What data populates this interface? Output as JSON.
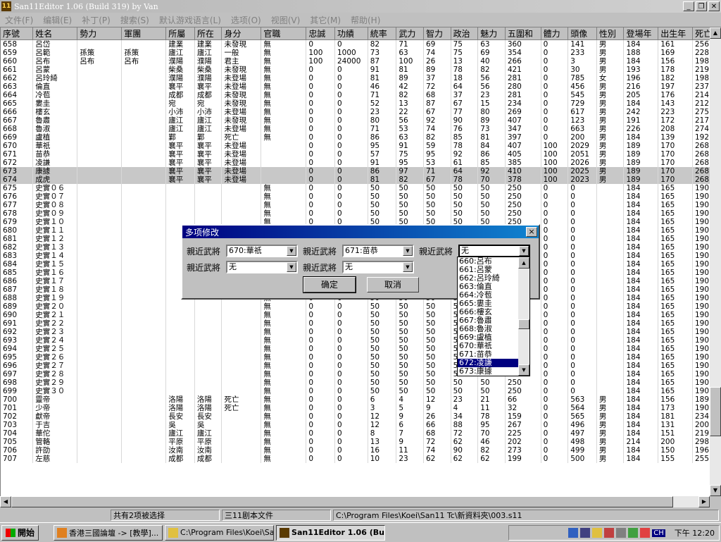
{
  "window": {
    "title": "San11Editor 1.06 (Build 319) by Van",
    "app_icon": "11"
  },
  "menubar": [
    "文件(F)",
    "编辑(E)",
    "补丁(P)",
    "搜索(S)",
    "默认游戏语言(L)",
    "选项(O)",
    "视图(V)",
    "其它(M)",
    "帮助(H)"
  ],
  "table": {
    "columns": [
      "序號",
      "姓名",
      "勢力",
      "軍團",
      "所屬",
      "所在",
      "身分",
      "官職",
      "忠誠",
      "功績",
      "統率",
      "武力",
      "智力",
      "政治",
      "魅力",
      "五圍和",
      "體力",
      "頭像",
      "性別",
      "登場年",
      "出生年",
      "死亡年"
    ],
    "rows": [
      [
        "658",
        "呂岱",
        "",
        "",
        "建業",
        "建業",
        "未發現",
        "無",
        "0",
        "0",
        "82",
        "71",
        "69",
        "75",
        "63",
        "360",
        "0",
        "141",
        "男",
        "184",
        "161",
        "256"
      ],
      [
        "659",
        "呂範",
        "孫策",
        "孫策",
        "廬江",
        "廬江",
        "一般",
        "無",
        "100",
        "1000",
        "73",
        "63",
        "74",
        "75",
        "69",
        "354",
        "0",
        "233",
        "男",
        "188",
        "169",
        "228"
      ],
      [
        "660",
        "呂布",
        "呂布",
        "呂布",
        "濮陽",
        "濮陽",
        "君主",
        "無",
        "100",
        "24000",
        "87",
        "100",
        "26",
        "13",
        "40",
        "266",
        "0",
        "3",
        "男",
        "184",
        "156",
        "198"
      ],
      [
        "661",
        "呂蒙",
        "",
        "",
        "柴桑",
        "柴桑",
        "未發現",
        "無",
        "0",
        "0",
        "91",
        "81",
        "89",
        "78",
        "82",
        "421",
        "0",
        "30",
        "男",
        "193",
        "178",
        "219"
      ],
      [
        "662",
        "呂玲綺",
        "",
        "",
        "濮陽",
        "濮陽",
        "未登場",
        "無",
        "0",
        "0",
        "81",
        "89",
        "37",
        "18",
        "56",
        "281",
        "0",
        "785",
        "女",
        "196",
        "182",
        "198"
      ],
      [
        "663",
        "倫直",
        "",
        "",
        "襄平",
        "襄平",
        "未登場",
        "無",
        "0",
        "0",
        "46",
        "42",
        "72",
        "64",
        "56",
        "280",
        "0",
        "456",
        "男",
        "216",
        "197",
        "237"
      ],
      [
        "664",
        "冷苞",
        "",
        "",
        "成都",
        "成都",
        "未發現",
        "無",
        "0",
        "0",
        "71",
        "82",
        "68",
        "37",
        "23",
        "281",
        "0",
        "545",
        "男",
        "205",
        "176",
        "214"
      ],
      [
        "665",
        "婁圭",
        "",
        "",
        "宛",
        "宛",
        "未發現",
        "無",
        "0",
        "0",
        "52",
        "13",
        "87",
        "67",
        "15",
        "234",
        "0",
        "729",
        "男",
        "184",
        "143",
        "212"
      ],
      [
        "666",
        "樓玄",
        "",
        "",
        "小沛",
        "小沛",
        "未登場",
        "無",
        "0",
        "0",
        "23",
        "22",
        "67",
        "77",
        "80",
        "269",
        "0",
        "617",
        "男",
        "242",
        "223",
        "275"
      ],
      [
        "667",
        "魯肅",
        "",
        "",
        "廬江",
        "廬江",
        "未發現",
        "無",
        "0",
        "0",
        "80",
        "56",
        "92",
        "90",
        "89",
        "407",
        "0",
        "123",
        "男",
        "191",
        "172",
        "217"
      ],
      [
        "668",
        "魯淑",
        "",
        "",
        "廬江",
        "廬江",
        "未登場",
        "無",
        "0",
        "0",
        "71",
        "53",
        "74",
        "76",
        "73",
        "347",
        "0",
        "663",
        "男",
        "226",
        "208",
        "274"
      ],
      [
        "669",
        "盧植",
        "",
        "",
        "鄴",
        "鄴",
        "死亡",
        "無",
        "0",
        "0",
        "86",
        "63",
        "82",
        "85",
        "81",
        "397",
        "0",
        "200",
        "男",
        "184",
        "139",
        "192"
      ],
      [
        "670",
        "華祇",
        "",
        "",
        "襄平",
        "襄平",
        "未登場",
        "",
        "0",
        "0",
        "95",
        "91",
        "59",
        "78",
        "84",
        "407",
        "100",
        "2029",
        "男",
        "189",
        "170",
        "268"
      ],
      [
        "671",
        "苗恭",
        "",
        "",
        "襄平",
        "襄平",
        "未登場",
        "",
        "0",
        "0",
        "57",
        "75",
        "95",
        "92",
        "86",
        "405",
        "100",
        "2051",
        "男",
        "189",
        "170",
        "268"
      ],
      [
        "672",
        "凌謙",
        "",
        "",
        "襄平",
        "襄平",
        "未登場",
        "",
        "0",
        "0",
        "91",
        "95",
        "53",
        "61",
        "85",
        "385",
        "100",
        "2026",
        "男",
        "189",
        "170",
        "268"
      ],
      [
        "673",
        "康據",
        "",
        "",
        "襄平",
        "襄平",
        "未登場",
        "",
        "0",
        "0",
        "86",
        "97",
        "71",
        "64",
        "92",
        "410",
        "100",
        "2025",
        "男",
        "189",
        "170",
        "268"
      ],
      [
        "674",
        "成虎",
        "",
        "",
        "襄平",
        "襄平",
        "未登場",
        "",
        "0",
        "0",
        "81",
        "82",
        "67",
        "78",
        "70",
        "378",
        "100",
        "2023",
        "男",
        "189",
        "170",
        "268"
      ],
      [
        "675",
        "史實０６",
        "",
        "",
        "",
        "",
        "",
        "無",
        "0",
        "0",
        "50",
        "50",
        "50",
        "50",
        "50",
        "250",
        "0",
        "0",
        "",
        "184",
        "165",
        "190"
      ],
      [
        "676",
        "史實０７",
        "",
        "",
        "",
        "",
        "",
        "無",
        "0",
        "0",
        "50",
        "50",
        "50",
        "50",
        "50",
        "250",
        "0",
        "0",
        "",
        "184",
        "165",
        "190"
      ],
      [
        "677",
        "史實０８",
        "",
        "",
        "",
        "",
        "",
        "無",
        "0",
        "0",
        "50",
        "50",
        "50",
        "50",
        "50",
        "250",
        "0",
        "0",
        "",
        "184",
        "165",
        "190"
      ],
      [
        "678",
        "史實０９",
        "",
        "",
        "",
        "",
        "",
        "無",
        "0",
        "0",
        "50",
        "50",
        "50",
        "50",
        "50",
        "250",
        "0",
        "0",
        "",
        "184",
        "165",
        "190"
      ],
      [
        "679",
        "史實１０",
        "",
        "",
        "",
        "",
        "",
        "無",
        "0",
        "0",
        "50",
        "50",
        "50",
        "50",
        "50",
        "250",
        "0",
        "0",
        "",
        "184",
        "165",
        "190"
      ],
      [
        "680",
        "史實１１",
        "",
        "",
        "",
        "",
        "",
        "無",
        "0",
        "0",
        "50",
        "50",
        "50",
        "50",
        "50",
        "250",
        "0",
        "0",
        "",
        "184",
        "165",
        "190"
      ],
      [
        "681",
        "史實１２",
        "",
        "",
        "",
        "",
        "",
        "無",
        "0",
        "0",
        "50",
        "50",
        "50",
        "50",
        "50",
        "250",
        "0",
        "0",
        "",
        "184",
        "165",
        "190"
      ],
      [
        "682",
        "史實１３",
        "",
        "",
        "",
        "",
        "",
        "無",
        "0",
        "0",
        "50",
        "50",
        "50",
        "50",
        "50",
        "250",
        "0",
        "0",
        "",
        "184",
        "165",
        "190"
      ],
      [
        "683",
        "史實１４",
        "",
        "",
        "",
        "",
        "",
        "無",
        "0",
        "0",
        "50",
        "50",
        "50",
        "50",
        "50",
        "250",
        "0",
        "0",
        "",
        "184",
        "165",
        "190"
      ],
      [
        "684",
        "史實１５",
        "",
        "",
        "",
        "",
        "",
        "無",
        "0",
        "0",
        "50",
        "50",
        "50",
        "50",
        "50",
        "250",
        "0",
        "0",
        "",
        "184",
        "165",
        "190"
      ],
      [
        "685",
        "史實１６",
        "",
        "",
        "",
        "",
        "",
        "無",
        "0",
        "0",
        "50",
        "50",
        "50",
        "50",
        "50",
        "250",
        "0",
        "0",
        "",
        "184",
        "165",
        "190"
      ],
      [
        "686",
        "史實１７",
        "",
        "",
        "",
        "",
        "",
        "無",
        "0",
        "0",
        "50",
        "50",
        "50",
        "50",
        "50",
        "250",
        "0",
        "0",
        "",
        "184",
        "165",
        "190"
      ],
      [
        "687",
        "史實１８",
        "",
        "",
        "",
        "",
        "",
        "無",
        "0",
        "0",
        "50",
        "50",
        "50",
        "50",
        "50",
        "250",
        "0",
        "0",
        "",
        "184",
        "165",
        "190"
      ],
      [
        "688",
        "史實１９",
        "",
        "",
        "",
        "",
        "",
        "無",
        "0",
        "0",
        "50",
        "50",
        "50",
        "50",
        "50",
        "250",
        "0",
        "0",
        "",
        "184",
        "165",
        "190"
      ],
      [
        "689",
        "史實２０",
        "",
        "",
        "",
        "",
        "",
        "無",
        "0",
        "0",
        "50",
        "50",
        "50",
        "50",
        "50",
        "250",
        "0",
        "0",
        "",
        "184",
        "165",
        "190"
      ],
      [
        "690",
        "史實２１",
        "",
        "",
        "",
        "",
        "",
        "無",
        "0",
        "0",
        "50",
        "50",
        "50",
        "50",
        "50",
        "250",
        "0",
        "0",
        "",
        "184",
        "165",
        "190"
      ],
      [
        "691",
        "史實２２",
        "",
        "",
        "",
        "",
        "",
        "無",
        "0",
        "0",
        "50",
        "50",
        "50",
        "50",
        "50",
        "250",
        "0",
        "0",
        "",
        "184",
        "165",
        "190"
      ],
      [
        "692",
        "史實２３",
        "",
        "",
        "",
        "",
        "",
        "無",
        "0",
        "0",
        "50",
        "50",
        "50",
        "50",
        "50",
        "250",
        "0",
        "0",
        "",
        "184",
        "165",
        "190"
      ],
      [
        "693",
        "史實２４",
        "",
        "",
        "",
        "",
        "",
        "無",
        "0",
        "0",
        "50",
        "50",
        "50",
        "50",
        "50",
        "250",
        "0",
        "0",
        "",
        "184",
        "165",
        "190"
      ],
      [
        "694",
        "史實２５",
        "",
        "",
        "",
        "",
        "",
        "無",
        "0",
        "0",
        "50",
        "50",
        "50",
        "50",
        "50",
        "250",
        "0",
        "0",
        "",
        "184",
        "165",
        "190"
      ],
      [
        "695",
        "史實２６",
        "",
        "",
        "",
        "",
        "",
        "無",
        "0",
        "0",
        "50",
        "50",
        "50",
        "50",
        "50",
        "250",
        "0",
        "0",
        "",
        "184",
        "165",
        "190"
      ],
      [
        "696",
        "史實２７",
        "",
        "",
        "",
        "",
        "",
        "無",
        "0",
        "0",
        "50",
        "50",
        "50",
        "50",
        "50",
        "250",
        "0",
        "0",
        "",
        "184",
        "165",
        "190"
      ],
      [
        "697",
        "史實２８",
        "",
        "",
        "",
        "",
        "",
        "無",
        "0",
        "0",
        "50",
        "50",
        "50",
        "50",
        "50",
        "250",
        "0",
        "0",
        "",
        "184",
        "165",
        "190"
      ],
      [
        "698",
        "史實２９",
        "",
        "",
        "",
        "",
        "",
        "無",
        "0",
        "0",
        "50",
        "50",
        "50",
        "50",
        "50",
        "250",
        "0",
        "0",
        "",
        "184",
        "165",
        "190"
      ],
      [
        "699",
        "史實３０",
        "",
        "",
        "",
        "",
        "",
        "無",
        "0",
        "0",
        "50",
        "50",
        "50",
        "50",
        "50",
        "250",
        "0",
        "0",
        "",
        "184",
        "165",
        "190"
      ],
      [
        "700",
        "靈帝",
        "",
        "",
        "洛陽",
        "洛陽",
        "死亡",
        "無",
        "0",
        "0",
        "6",
        "4",
        "12",
        "23",
        "21",
        "66",
        "0",
        "563",
        "男",
        "184",
        "156",
        "189"
      ],
      [
        "701",
        "少帝",
        "",
        "",
        "洛陽",
        "洛陽",
        "死亡",
        "無",
        "0",
        "0",
        "3",
        "5",
        "9",
        "4",
        "11",
        "32",
        "0",
        "564",
        "男",
        "184",
        "173",
        "190"
      ],
      [
        "702",
        "獻帝",
        "",
        "",
        "長安",
        "長安",
        "",
        "無",
        "0",
        "0",
        "12",
        "9",
        "26",
        "34",
        "78",
        "159",
        "0",
        "565",
        "男",
        "184",
        "181",
        "234"
      ],
      [
        "703",
        "于吉",
        "",
        "",
        "吳",
        "吳",
        "",
        "無",
        "0",
        "0",
        "12",
        "6",
        "66",
        "88",
        "95",
        "267",
        "0",
        "496",
        "男",
        "184",
        "131",
        "200"
      ],
      [
        "704",
        "華佗",
        "",
        "",
        "廬江",
        "廬江",
        "",
        "無",
        "0",
        "0",
        "8",
        "7",
        "68",
        "72",
        "70",
        "225",
        "0",
        "497",
        "男",
        "184",
        "151",
        "219"
      ],
      [
        "705",
        "管輅",
        "",
        "",
        "平原",
        "平原",
        "",
        "無",
        "0",
        "0",
        "13",
        "9",
        "72",
        "62",
        "46",
        "202",
        "0",
        "498",
        "男",
        "214",
        "200",
        "298"
      ],
      [
        "706",
        "許劭",
        "",
        "",
        "汝南",
        "汝南",
        "",
        "無",
        "0",
        "0",
        "16",
        "11",
        "74",
        "90",
        "82",
        "273",
        "0",
        "499",
        "男",
        "184",
        "150",
        "196"
      ],
      [
        "707",
        "左慈",
        "",
        "",
        "成都",
        "成都",
        "",
        "無",
        "0",
        "0",
        "10",
        "23",
        "62",
        "62",
        "62",
        "199",
        "0",
        "500",
        "男",
        "184",
        "155",
        "255"
      ]
    ],
    "selected_rows": [
      "673",
      "674"
    ]
  },
  "statusbar": {
    "selection": "共有2项被选择",
    "script": "三11剧本文件",
    "path": "C:\\Program Files\\Koei\\San11 Tc\\新資料夾\\003.s11"
  },
  "dialog": {
    "title": "多项修改",
    "fields": [
      {
        "label": "親近武將",
        "value": "670:華祇"
      },
      {
        "label": "親近武將",
        "value": "671:苗恭"
      },
      {
        "label": "親近武將",
        "value": "无"
      },
      {
        "label": "親近武將",
        "value": "无"
      },
      {
        "label": "親近武將",
        "value": "无"
      }
    ],
    "ok_label": "确定",
    "cancel_label": "取消"
  },
  "dropdown": {
    "items": [
      "660:呂布",
      "661:呂蒙",
      "662:呂玲綺",
      "663:倫直",
      "664:冷苞",
      "665:婁圭",
      "666:樓玄",
      "667:魯肅",
      "668:魯淑",
      "669:盧植",
      "670:華祇",
      "671:苗恭",
      "672:凌謙",
      "673:康據"
    ],
    "highlighted": "672:凌謙"
  },
  "taskbar": {
    "start_label": "開始",
    "tasks": [
      {
        "label": "香港三國論壇 -> [教學]...",
        "icon": "browser-icon",
        "active": false
      },
      {
        "label": "C:\\Program Files\\Koei\\San...",
        "icon": "folder-icon",
        "active": false
      },
      {
        "label": "San11Editor 1.06 (Build 3...",
        "icon": "app-icon",
        "active": true
      }
    ],
    "tray_ime": "CH",
    "clock": "下午 12:20"
  },
  "colors": {
    "title_active": "#000080",
    "title_inactive": "#b6b6b6",
    "selection": "#000080"
  }
}
